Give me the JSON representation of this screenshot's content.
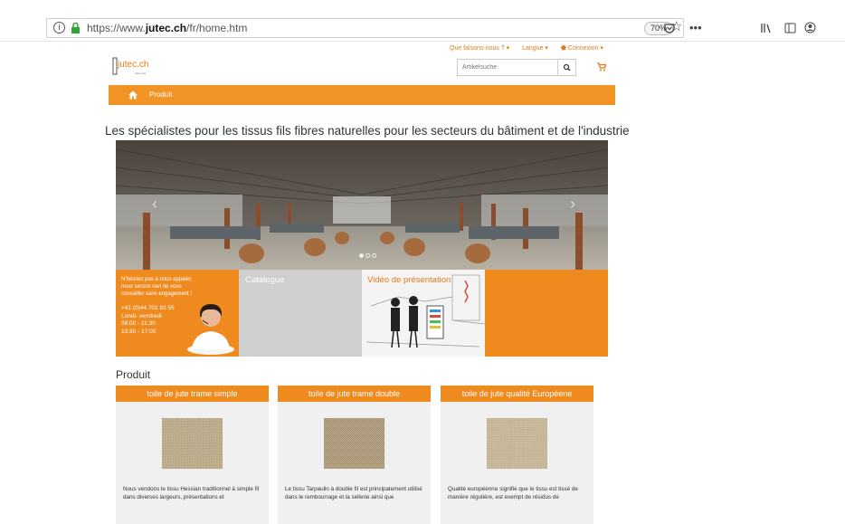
{
  "browser": {
    "url_prefix": "https://www.",
    "url_domain": "jutec.ch",
    "url_path": "/fr/home.htm",
    "zoom": "70%"
  },
  "topnav": {
    "items": [
      "Que faisons-nous ? ▾",
      "Langue ▾",
      "⬟ Connexion ▾"
    ]
  },
  "logo": {
    "text": "jutec.ch",
    "sub": "Jutec AG"
  },
  "search": {
    "placeholder": "Artikelsuche"
  },
  "nav": {
    "link": "Produit"
  },
  "headline": "Les spécialistes pour les tissus fils fibres naturelles pour les secteurs du bâtiment et de l'industrie",
  "slider": {
    "prev": "‹",
    "next": "›"
  },
  "tiles": {
    "contact_text": "N'hésitez pas à nous appeler, nous serons ravi de vous conseiller sans engagement !",
    "phone": "+41 (0)44 701 82 55",
    "days": "Lundi- vendredi",
    "hours1": "08:00 - 11:30",
    "hours2": "13:30 - 17:00",
    "catalogue": "Catalogue",
    "video": "Vidéo de présentation"
  },
  "products": {
    "title": "Produit",
    "items": [
      {
        "name": "toile de jute trame simple",
        "desc": "Nous vendons le tissu Hessian traditionnel à simple fil dans diverses largeurs, présentations et"
      },
      {
        "name": "toile de jute trame double",
        "desc": "Le tissu Tarpaulin à double fil est principalement utilisé dans le rembourrage et la sellerie ainsi que"
      },
      {
        "name": "toile de jute qualité Européene",
        "desc": "Qualité européenne signifie que le tissu est tissé de manière régulière, est exempt de résidus de"
      }
    ]
  },
  "colors": {
    "accent": "#f29325",
    "brand_text": "#e07c18"
  }
}
